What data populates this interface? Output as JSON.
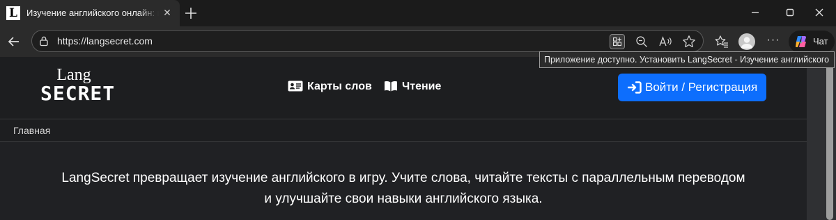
{
  "browser": {
    "tab": {
      "favicon_letter": "L",
      "title": "Изучение английского онлайн: изучение английских слов"
    },
    "address": {
      "url": "https://langsecret.com"
    },
    "copilot_label": "Чат",
    "tooltip": "Приложение доступно. Установить LangSecret - Изучение английского"
  },
  "site": {
    "logo": {
      "line1": "Lang",
      "line2": "SECRET"
    },
    "nav": {
      "cards": "Карты слов",
      "reading": "Чтение"
    },
    "login": {
      "label": "Войти",
      "separator": "/",
      "register": "Регистрация"
    },
    "breadcrumb": "Главная",
    "intro": {
      "line1": "LangSecret превращает изучение английского в игру. Учите слова, читайте тексты с параллельным переводом",
      "line2": "и улучшайте свои навыки английского языка."
    }
  },
  "colors": {
    "primary_button": "#0d6efd",
    "page_bg": "#202124",
    "navbar_bg": "#1d1e20"
  }
}
